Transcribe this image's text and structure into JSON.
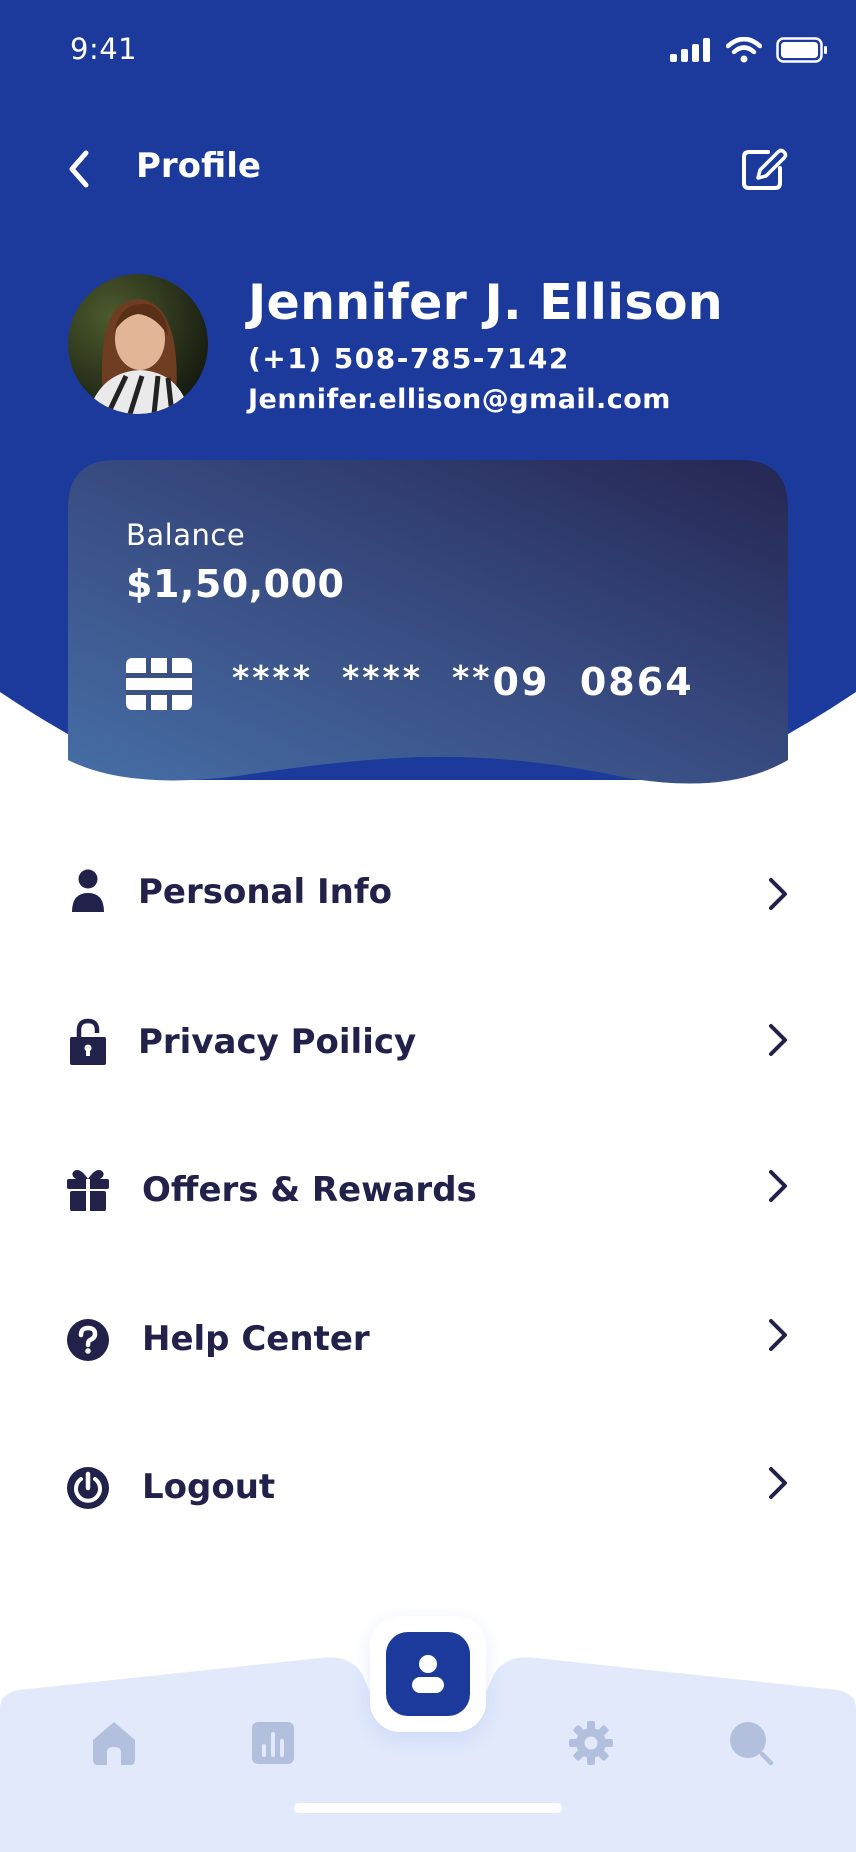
{
  "status_bar": {
    "time": "9:41"
  },
  "header": {
    "title": "Profile"
  },
  "profile": {
    "name": "Jennifer J. Ellison",
    "phone": "(+1) 508-785-7142",
    "email": "Jennifer.ellison@gmail.com"
  },
  "card": {
    "balance_label": "Balance",
    "balance_amount": "$1,50,000",
    "number_masked": "****  ****  **",
    "number_visible": "09  0864"
  },
  "menu": {
    "items": [
      {
        "label": "Personal Info",
        "icon": "person-icon"
      },
      {
        "label": "Privacy Poilicy",
        "icon": "lock-icon"
      },
      {
        "label": "Offers & Rewards",
        "icon": "gift-icon"
      },
      {
        "label": "Help Center",
        "icon": "help-icon"
      },
      {
        "label": "Logout",
        "icon": "power-icon"
      }
    ]
  },
  "bottom_nav": {
    "items": [
      "home-icon",
      "chart-icon",
      "profile-icon",
      "settings-icon",
      "search-icon"
    ],
    "active": "profile-icon"
  },
  "colors": {
    "primary": "#1b3a9c",
    "text_dark": "#21214a",
    "nav_bg": "#e1e9fb",
    "nav_icon": "#b2c0de"
  }
}
